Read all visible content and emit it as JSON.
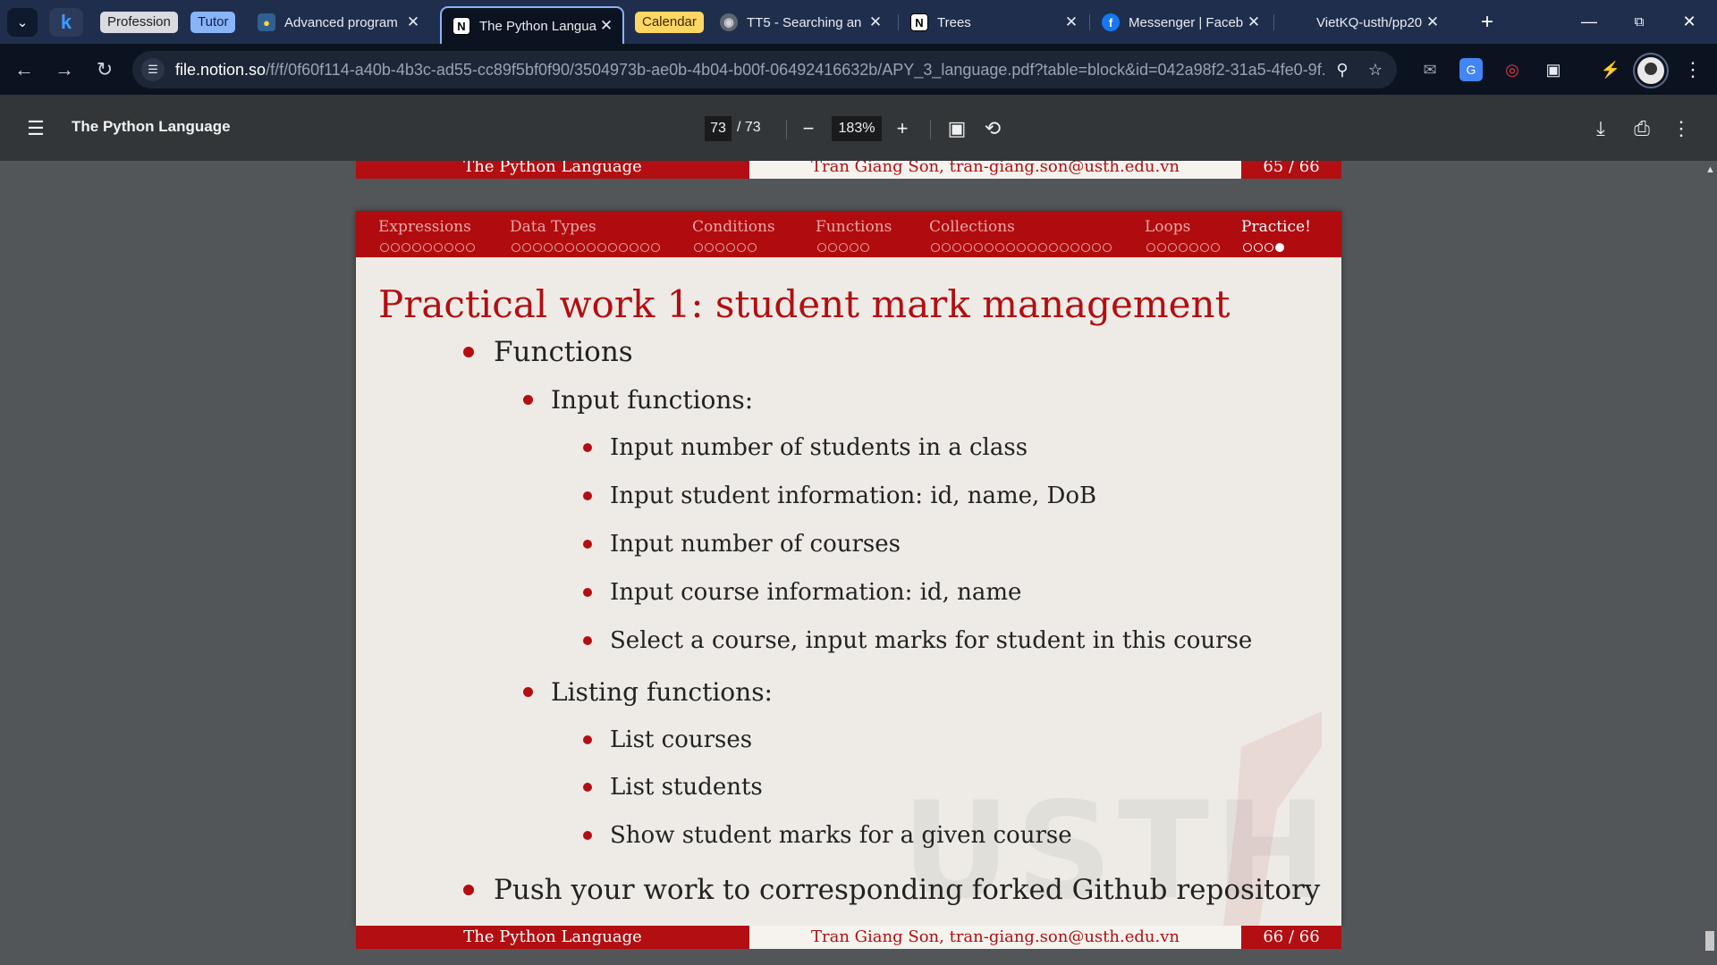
{
  "browser": {
    "group_chips": [
      {
        "label": "Profession",
        "bg": "#d9dbe0",
        "fg": "#1f1f1f"
      },
      {
        "label": "Tutor",
        "bg": "#8ab4f8",
        "fg": "#0b1f4a"
      },
      {
        "label": "Calendar",
        "bg": "#fdd663",
        "fg": "#3c2a00"
      }
    ],
    "tabs": [
      {
        "title": "Advanced program",
        "icon": "python-icon"
      },
      {
        "title": "The Python Langua",
        "icon": "notion-icon",
        "active": true
      },
      {
        "title": "TT5 - Searching an",
        "icon": "globe-icon"
      },
      {
        "title": "Trees",
        "icon": "notion-icon"
      },
      {
        "title": "Messenger | Faceb",
        "icon": "facebook-icon"
      },
      {
        "title": "VietKQ-usth/pp20",
        "icon": "github-icon"
      }
    ],
    "url_host": "file.notion.so",
    "url_path": "/f/f/0f60f114-a40b-4b3c-ad55-cc89f5bf0f90/3504973b-ae0b-4b04-b00f-06492416632b/APY_3_language.pdf?table=block&id=042a98f2-31a5-4fe0-9f..."
  },
  "pdf": {
    "title": "The Python Language",
    "page_current": "73",
    "page_total": "/ 73",
    "zoom": "183%"
  },
  "slide": {
    "nav": [
      {
        "label": "Expressions",
        "dots": 9,
        "filled": 0
      },
      {
        "label": "Data Types",
        "dots": 14,
        "filled": 0
      },
      {
        "label": "Conditions",
        "dots": 6,
        "filled": 0
      },
      {
        "label": "Functions",
        "dots": 5,
        "filled": 0
      },
      {
        "label": "Collections",
        "dots": 17,
        "filled": 0
      },
      {
        "label": "Loops",
        "dots": 7,
        "filled": 0
      },
      {
        "label": "Practice!",
        "dots": 4,
        "filled": 1,
        "current": true
      }
    ],
    "title": "Practical work 1: student mark management",
    "bullets": {
      "functions": "Functions",
      "input_functions": "Input functions:",
      "input_items": [
        "Input number of students in a class",
        "Input student information: id, name, DoB",
        "Input number of courses",
        "Input course information: id, name",
        "Select a course, input marks for student in this course"
      ],
      "listing_functions": "Listing functions:",
      "listing_items": [
        "List courses",
        "List students",
        "Show student marks for a given course"
      ],
      "push": "Push your work to corresponding forked Github repository"
    },
    "watermark": "USTH"
  },
  "prev_footer": {
    "title": "The Python Language",
    "author": "Tran Giang Son, tran-giang.son@usth.edu.vn",
    "page": "65 / 66"
  },
  "footer": {
    "title": "The Python Language",
    "author": "Tran Giang Son, tran-giang.son@usth.edu.vn",
    "page": "66 / 66"
  }
}
